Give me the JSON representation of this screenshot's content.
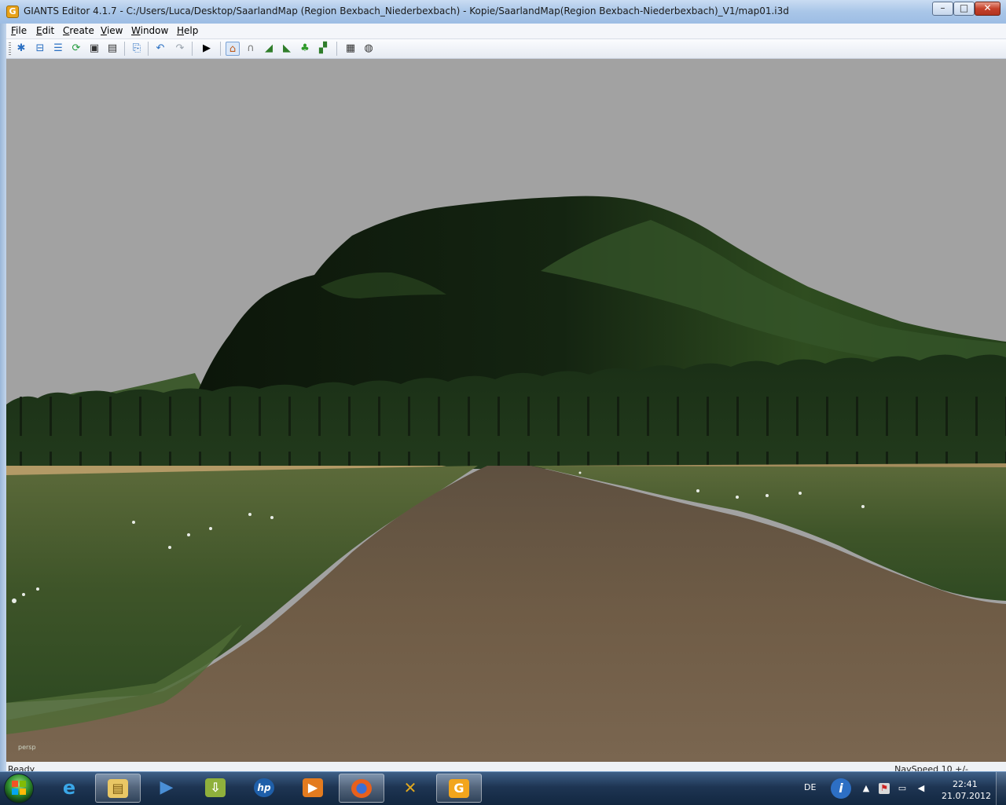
{
  "window": {
    "title": "GIANTS Editor 4.1.7 - C:/Users/Luca/Desktop/SaarlandMap (Region Bexbach_Niederbexbach) - Kopie/SaarlandMap(Region Bexbach-Niederbexbach)_V1/map01.i3d",
    "minimize_glyph": "–",
    "maximize_glyph": "□",
    "close_glyph": "✕",
    "app_icon_glyph": "G"
  },
  "menu": {
    "items": [
      {
        "label": "File"
      },
      {
        "label": "Edit"
      },
      {
        "label": "Create"
      },
      {
        "label": "View"
      },
      {
        "label": "Window"
      },
      {
        "label": "Help"
      }
    ]
  },
  "toolbar": {
    "buttons": [
      {
        "icon": "new-file-icon"
      },
      {
        "icon": "open-folder-icon"
      },
      {
        "icon": "document-list-icon"
      },
      {
        "icon": "refresh-icon"
      },
      {
        "icon": "save-icon"
      },
      {
        "icon": "save-as-icon"
      },
      {
        "icon": "import-icon"
      },
      {
        "icon": "undo-icon"
      },
      {
        "icon": "redo-icon"
      },
      {
        "icon": "play-icon"
      },
      {
        "icon": "home-icon"
      },
      {
        "icon": "magnet-icon"
      },
      {
        "icon": "terrain-sculpt-icon"
      },
      {
        "icon": "terrain-paint-icon"
      },
      {
        "icon": "foliage-paint-icon"
      },
      {
        "icon": "terrain-detail-icon"
      },
      {
        "icon": "checker-icon"
      },
      {
        "icon": "checker-sphere-icon"
      }
    ]
  },
  "viewport": {
    "camera_label": "persp",
    "colors": {
      "sky": "#a2a2a2",
      "hill_dark": "#0e1a0c",
      "hill_green": "#2c4a1e",
      "treeline": "#1d3318",
      "grass": "#4a5e33",
      "path": "#6e5b45",
      "field": "#b39a66"
    }
  },
  "status": {
    "left": "Ready",
    "right": "NavSpeed 10 +/-"
  },
  "taskbar": {
    "apps": [
      {
        "name": "internet-explorer",
        "glyph": "e",
        "color": "#3aa7e8"
      },
      {
        "name": "file-explorer",
        "glyph": "▤",
        "color": "#e9c765"
      },
      {
        "name": "media-player",
        "glyph": "▶",
        "color": "#4a8fd6"
      },
      {
        "name": "installer",
        "glyph": "⇩",
        "color": "#8fb03c"
      },
      {
        "name": "hp-utility",
        "glyph": "hp",
        "color": "#1f5fa9"
      },
      {
        "name": "media-center",
        "glyph": "▶",
        "color": "#e37b1f"
      },
      {
        "name": "firefox",
        "glyph": "◉",
        "color": "#e8601c"
      },
      {
        "name": "tools-app",
        "glyph": "✕",
        "color": "#e0a81f"
      },
      {
        "name": "giants-editor",
        "glyph": "G",
        "color": "#f2a51c"
      }
    ],
    "language": "DE",
    "time": "22:41",
    "date": "21.07.2012"
  }
}
